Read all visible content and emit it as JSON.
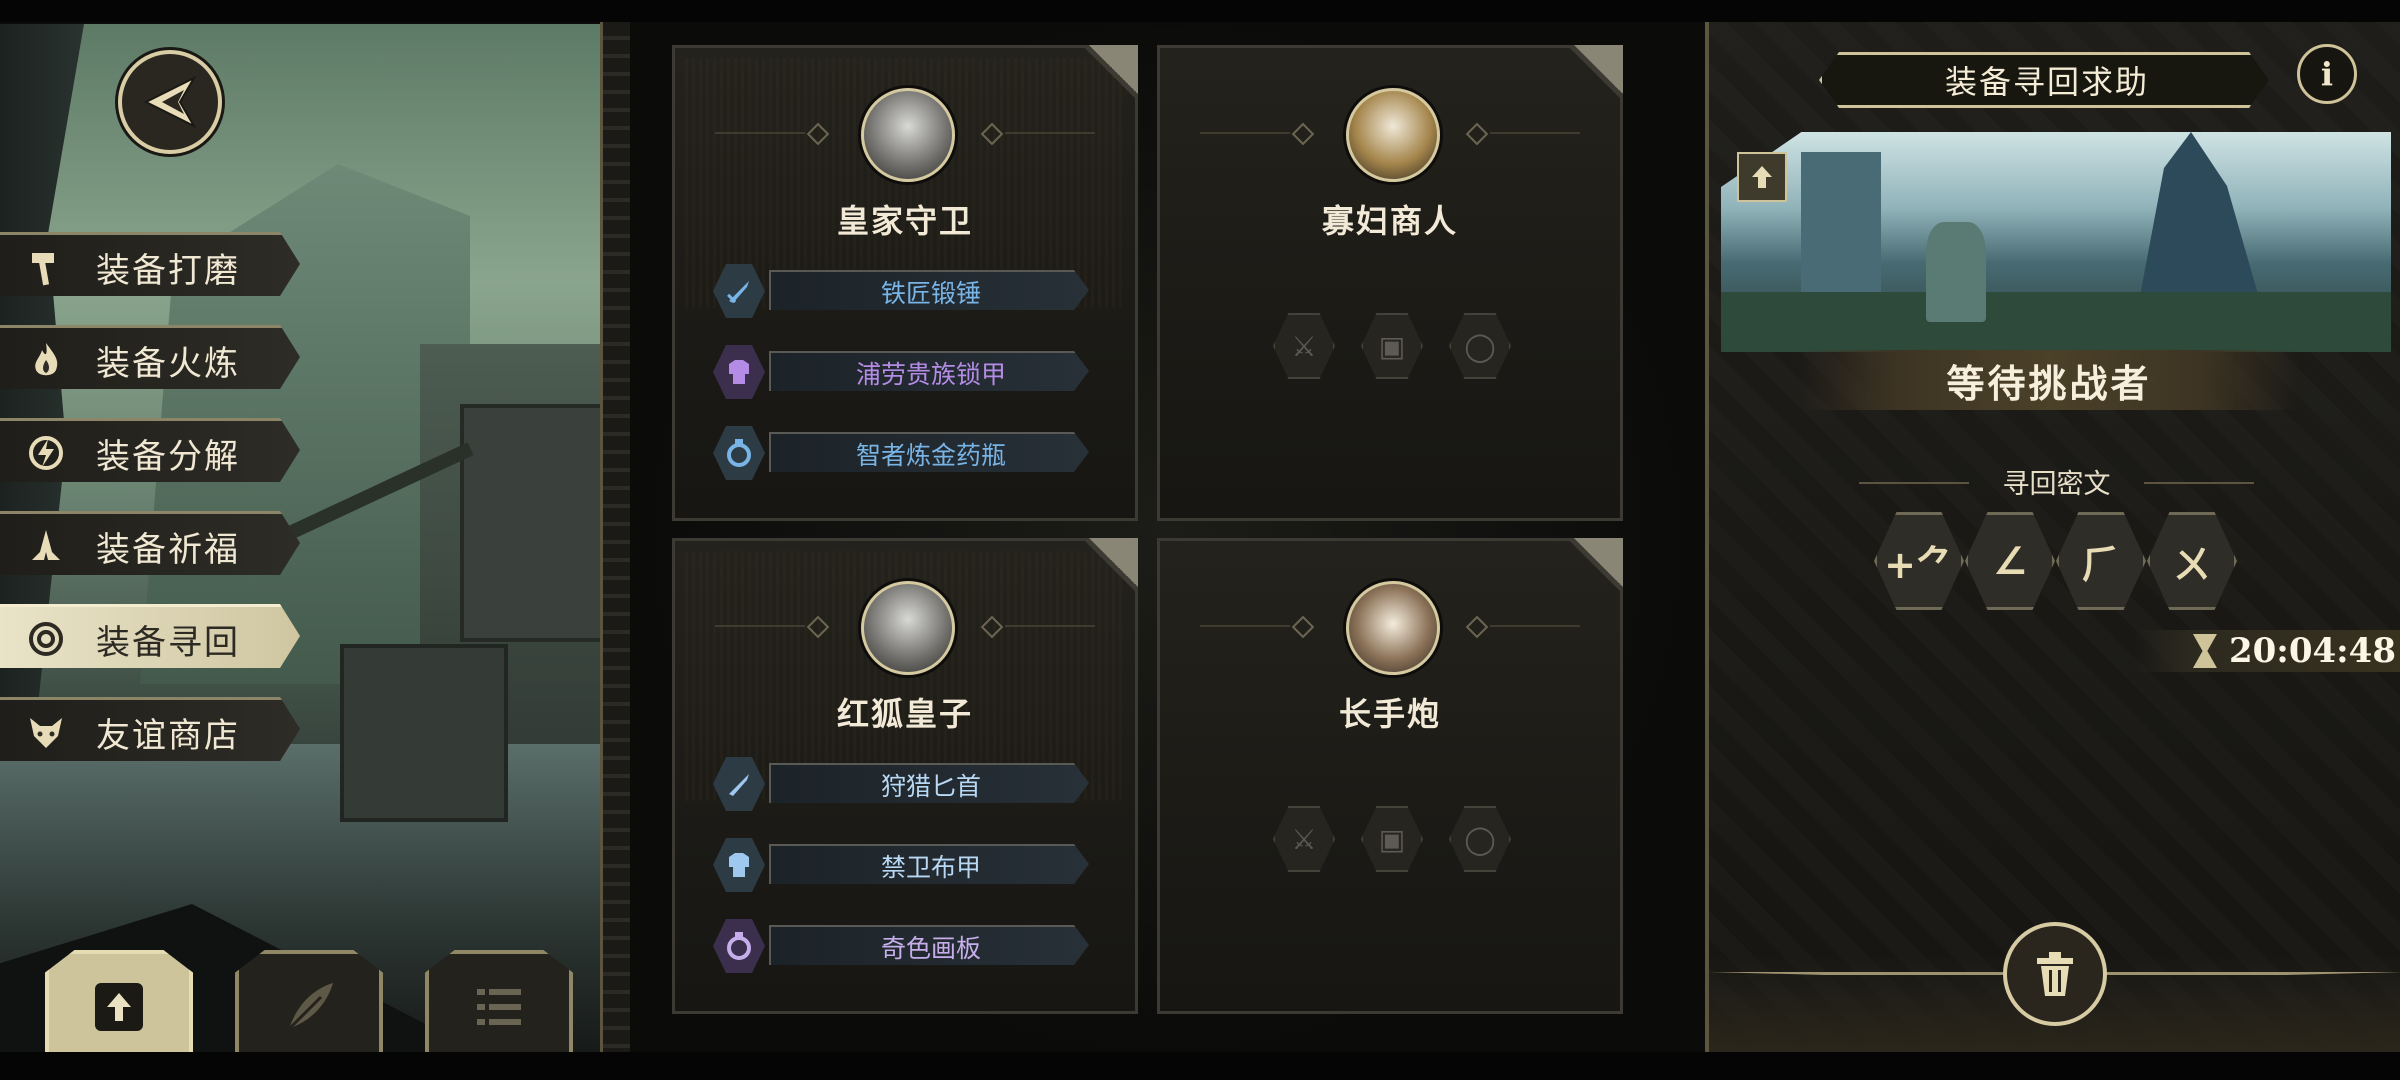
{
  "menu": {
    "items": [
      {
        "label": "装备打磨",
        "icon": "hammer-icon",
        "active": false
      },
      {
        "label": "装备火炼",
        "icon": "flame-icon",
        "active": false
      },
      {
        "label": "装备分解",
        "icon": "decompose-icon",
        "active": false
      },
      {
        "label": "装备祈福",
        "icon": "pray-hands-icon",
        "active": false
      },
      {
        "label": "装备寻回",
        "icon": "target-icon",
        "active": true
      },
      {
        "label": "友谊商店",
        "icon": "fox-icon",
        "active": false
      }
    ],
    "bottom_tabs": [
      {
        "icon": "upload-file-icon",
        "active": true
      },
      {
        "icon": "feather-icon",
        "active": false
      },
      {
        "icon": "list-icon",
        "active": false
      }
    ]
  },
  "cards": [
    {
      "name": "皇家守卫",
      "avatar": "royal-guard-avatar",
      "equipment": [
        {
          "label": "铁匠锻锤",
          "type": "weapon",
          "color": "#78b4e6"
        },
        {
          "label": "浦劳贵族锁甲",
          "type": "armor",
          "color": "#b48ce6"
        },
        {
          "label": "智者炼金药瓶",
          "type": "accessory",
          "color": "#78b4e6"
        }
      ]
    },
    {
      "name": "寡妇商人",
      "avatar": "widow-merchant-avatar",
      "equipment": []
    },
    {
      "name": "红狐皇子",
      "avatar": "red-fox-prince-avatar",
      "equipment": [
        {
          "label": "狩猎匕首",
          "type": "weapon",
          "color": "#b8d8f4"
        },
        {
          "label": "禁卫布甲",
          "type": "armor",
          "color": "#b8d8f4"
        },
        {
          "label": "奇色画板",
          "type": "accessory",
          "color": "#c6aeea"
        }
      ]
    },
    {
      "name": "长手炮",
      "avatar": "long-arm-cannon-avatar",
      "equipment": []
    }
  ],
  "right_panel": {
    "title": "装备寻回求助",
    "info_label": "i",
    "status": "等待挑战者",
    "cipher_title": "寻回密文",
    "runes": [
      "+⺈",
      "∠",
      "⺁",
      "ㄨ"
    ],
    "timer": "20:04:48"
  },
  "colors": {
    "accent_gold": "#cfc39a",
    "blue_quality": "#78b4e6",
    "purple_quality": "#b48ce6"
  }
}
